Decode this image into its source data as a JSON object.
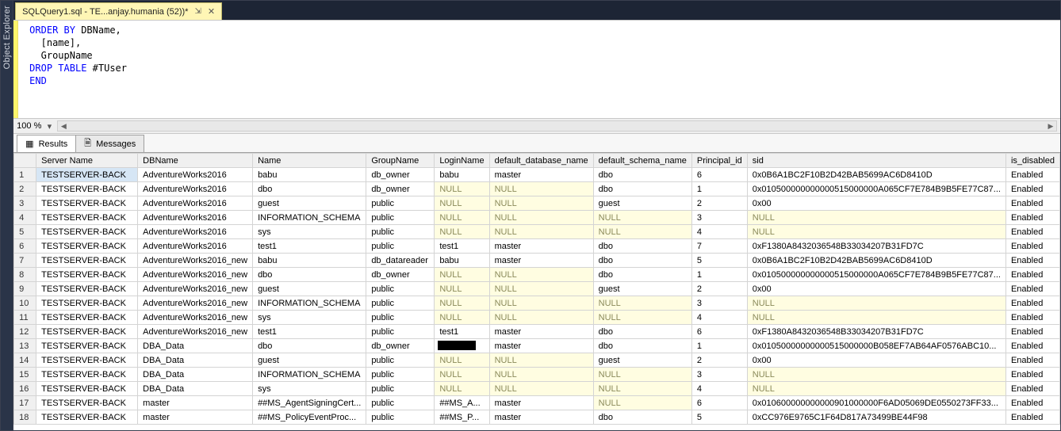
{
  "sidebar": {
    "label": "Object Explorer"
  },
  "tab": {
    "title": "SQLQuery1.sql - TE...anjay.humania (52))*",
    "pin_glyph": "⇲",
    "close_glyph": "✕"
  },
  "editor": {
    "lines": [
      {
        "segments": [
          {
            "cls": "kw",
            "t": "ORDER BY"
          },
          {
            "cls": "txt",
            "t": " DBName,"
          }
        ]
      },
      {
        "segments": [
          {
            "cls": "txt",
            "t": "  [name],"
          }
        ]
      },
      {
        "segments": [
          {
            "cls": "txt",
            "t": "  GroupName"
          }
        ]
      },
      {
        "segments": [
          {
            "cls": "txt",
            "t": ""
          }
        ]
      },
      {
        "segments": [
          {
            "cls": "kw",
            "t": "DROP TABLE"
          },
          {
            "cls": "txt",
            "t": " #TUser"
          }
        ]
      },
      {
        "segments": [
          {
            "cls": "kw",
            "t": "END"
          }
        ]
      }
    ]
  },
  "zoom": {
    "value": "100 %",
    "left_arrow": "◀",
    "right_arrow": "▶",
    "dd": "▾"
  },
  "panel_tabs": {
    "results": {
      "label": "Results",
      "icon": "▦"
    },
    "messages": {
      "label": "Messages",
      "icon": "🗎"
    }
  },
  "columns": [
    "Server Name",
    "DBName",
    "Name",
    "GroupName",
    "LoginName",
    "default_database_name",
    "default_schema_name",
    "Principal_id",
    "sid",
    "is_disabled"
  ],
  "rows": [
    {
      "n": 1,
      "sel": true,
      "cells": [
        "TESTSERVER-BACK",
        "AdventureWorks2016",
        "babu",
        "db_owner",
        "babu",
        "master",
        "dbo",
        "6",
        "0x0B6A1BC2F10B2D42BAB5699AC6D8410D",
        "Enabled"
      ]
    },
    {
      "n": 2,
      "cells": [
        "TESTSERVER-BACK",
        "AdventureWorks2016",
        "dbo",
        "db_owner",
        "NULL",
        "NULL",
        "dbo",
        "1",
        "0x010500000000000515000000A065CF7E784B9B5FE77C87...",
        "Enabled"
      ]
    },
    {
      "n": 3,
      "cells": [
        "TESTSERVER-BACK",
        "AdventureWorks2016",
        "guest",
        "public",
        "NULL",
        "NULL",
        "guest",
        "2",
        "0x00",
        "Enabled"
      ]
    },
    {
      "n": 4,
      "cells": [
        "TESTSERVER-BACK",
        "AdventureWorks2016",
        "INFORMATION_SCHEMA",
        "public",
        "NULL",
        "NULL",
        "NULL",
        "3",
        "NULL",
        "Enabled"
      ]
    },
    {
      "n": 5,
      "cells": [
        "TESTSERVER-BACK",
        "AdventureWorks2016",
        "sys",
        "public",
        "NULL",
        "NULL",
        "NULL",
        "4",
        "NULL",
        "Enabled"
      ]
    },
    {
      "n": 6,
      "cells": [
        "TESTSERVER-BACK",
        "AdventureWorks2016",
        "test1",
        "public",
        "test1",
        "master",
        "dbo",
        "7",
        "0xF1380A8432036548B33034207B31FD7C",
        "Enabled"
      ]
    },
    {
      "n": 7,
      "cells": [
        "TESTSERVER-BACK",
        "AdventureWorks2016_new",
        "babu",
        "db_datareader",
        "babu",
        "master",
        "dbo",
        "5",
        "0x0B6A1BC2F10B2D42BAB5699AC6D8410D",
        "Enabled"
      ]
    },
    {
      "n": 8,
      "cells": [
        "TESTSERVER-BACK",
        "AdventureWorks2016_new",
        "dbo",
        "db_owner",
        "NULL",
        "NULL",
        "dbo",
        "1",
        "0x010500000000000515000000A065CF7E784B9B5FE77C87...",
        "Enabled"
      ]
    },
    {
      "n": 9,
      "cells": [
        "TESTSERVER-BACK",
        "AdventureWorks2016_new",
        "guest",
        "public",
        "NULL",
        "NULL",
        "guest",
        "2",
        "0x00",
        "Enabled"
      ]
    },
    {
      "n": 10,
      "cells": [
        "TESTSERVER-BACK",
        "AdventureWorks2016_new",
        "INFORMATION_SCHEMA",
        "public",
        "NULL",
        "NULL",
        "NULL",
        "3",
        "NULL",
        "Enabled"
      ]
    },
    {
      "n": 11,
      "cells": [
        "TESTSERVER-BACK",
        "AdventureWorks2016_new",
        "sys",
        "public",
        "NULL",
        "NULL",
        "NULL",
        "4",
        "NULL",
        "Enabled"
      ]
    },
    {
      "n": 12,
      "cells": [
        "TESTSERVER-BACK",
        "AdventureWorks2016_new",
        "test1",
        "public",
        "test1",
        "master",
        "dbo",
        "6",
        "0xF1380A8432036548B33034207B31FD7C",
        "Enabled"
      ]
    },
    {
      "n": 13,
      "cells": [
        "TESTSERVER-BACK",
        "DBA_Data",
        "dbo",
        "db_owner",
        "[REDACTED]",
        "master",
        "dbo",
        "1",
        "0x01050000000000515000000B058EF7AB64AF0576ABC10...",
        "Enabled"
      ]
    },
    {
      "n": 14,
      "cells": [
        "TESTSERVER-BACK",
        "DBA_Data",
        "guest",
        "public",
        "NULL",
        "NULL",
        "guest",
        "2",
        "0x00",
        "Enabled"
      ]
    },
    {
      "n": 15,
      "cells": [
        "TESTSERVER-BACK",
        "DBA_Data",
        "INFORMATION_SCHEMA",
        "public",
        "NULL",
        "NULL",
        "NULL",
        "3",
        "NULL",
        "Enabled"
      ]
    },
    {
      "n": 16,
      "cells": [
        "TESTSERVER-BACK",
        "DBA_Data",
        "sys",
        "public",
        "NULL",
        "NULL",
        "NULL",
        "4",
        "NULL",
        "Enabled"
      ]
    },
    {
      "n": 17,
      "cells": [
        "TESTSERVER-BACK",
        "master",
        "##MS_AgentSigningCert...",
        "public",
        "##MS_A...",
        "master",
        "NULL",
        "6",
        "0x010600000000000901000000F6AD05069DE0550273FF33...",
        "Enabled"
      ]
    },
    {
      "n": 18,
      "cells": [
        "TESTSERVER-BACK",
        "master",
        "##MS_PolicyEventProc...",
        "public",
        "##MS_P...",
        "master",
        "dbo",
        "5",
        "0xCC976E9765C1F64D817A73499BE44F98",
        "Enabled"
      ]
    }
  ]
}
